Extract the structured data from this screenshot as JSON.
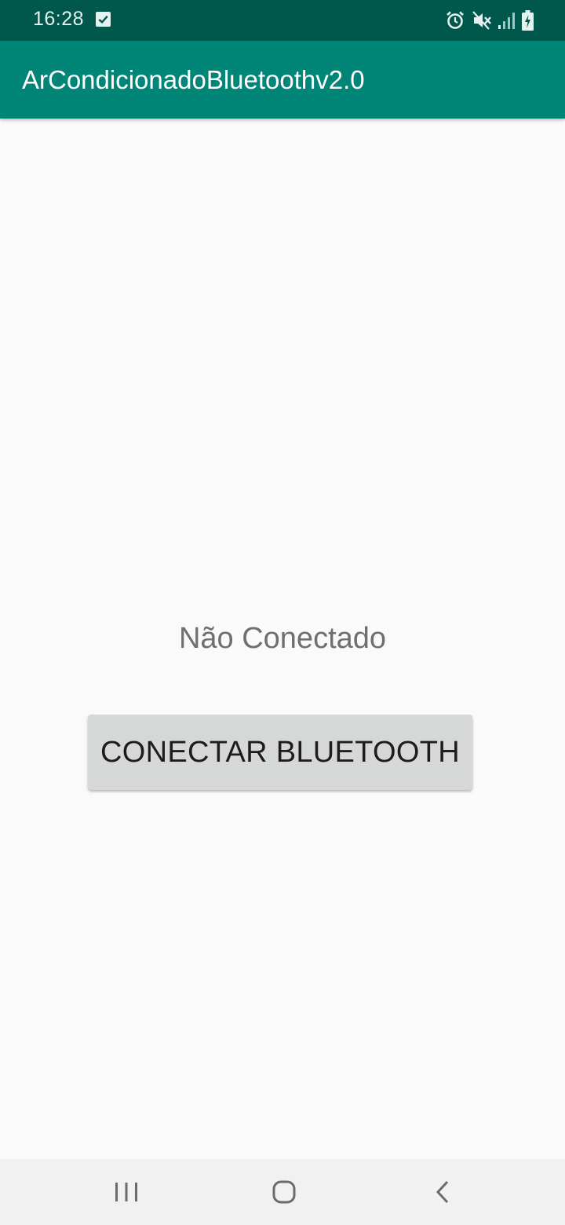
{
  "status_bar": {
    "time": "16:28",
    "icons": [
      "checkbox-notification-icon",
      "alarm-icon",
      "mute-icon",
      "signal-icon",
      "battery-icon"
    ],
    "background": "#00574b"
  },
  "app_bar": {
    "title": "ArCondicionadoBluetoothv2.0",
    "background": "#008577"
  },
  "main": {
    "connection_status": "Não Conectado",
    "connect_button_label": "CONECTAR BLUETOOTH"
  },
  "nav_bar": {
    "buttons": [
      "recents-icon",
      "home-icon",
      "back-icon"
    ]
  }
}
